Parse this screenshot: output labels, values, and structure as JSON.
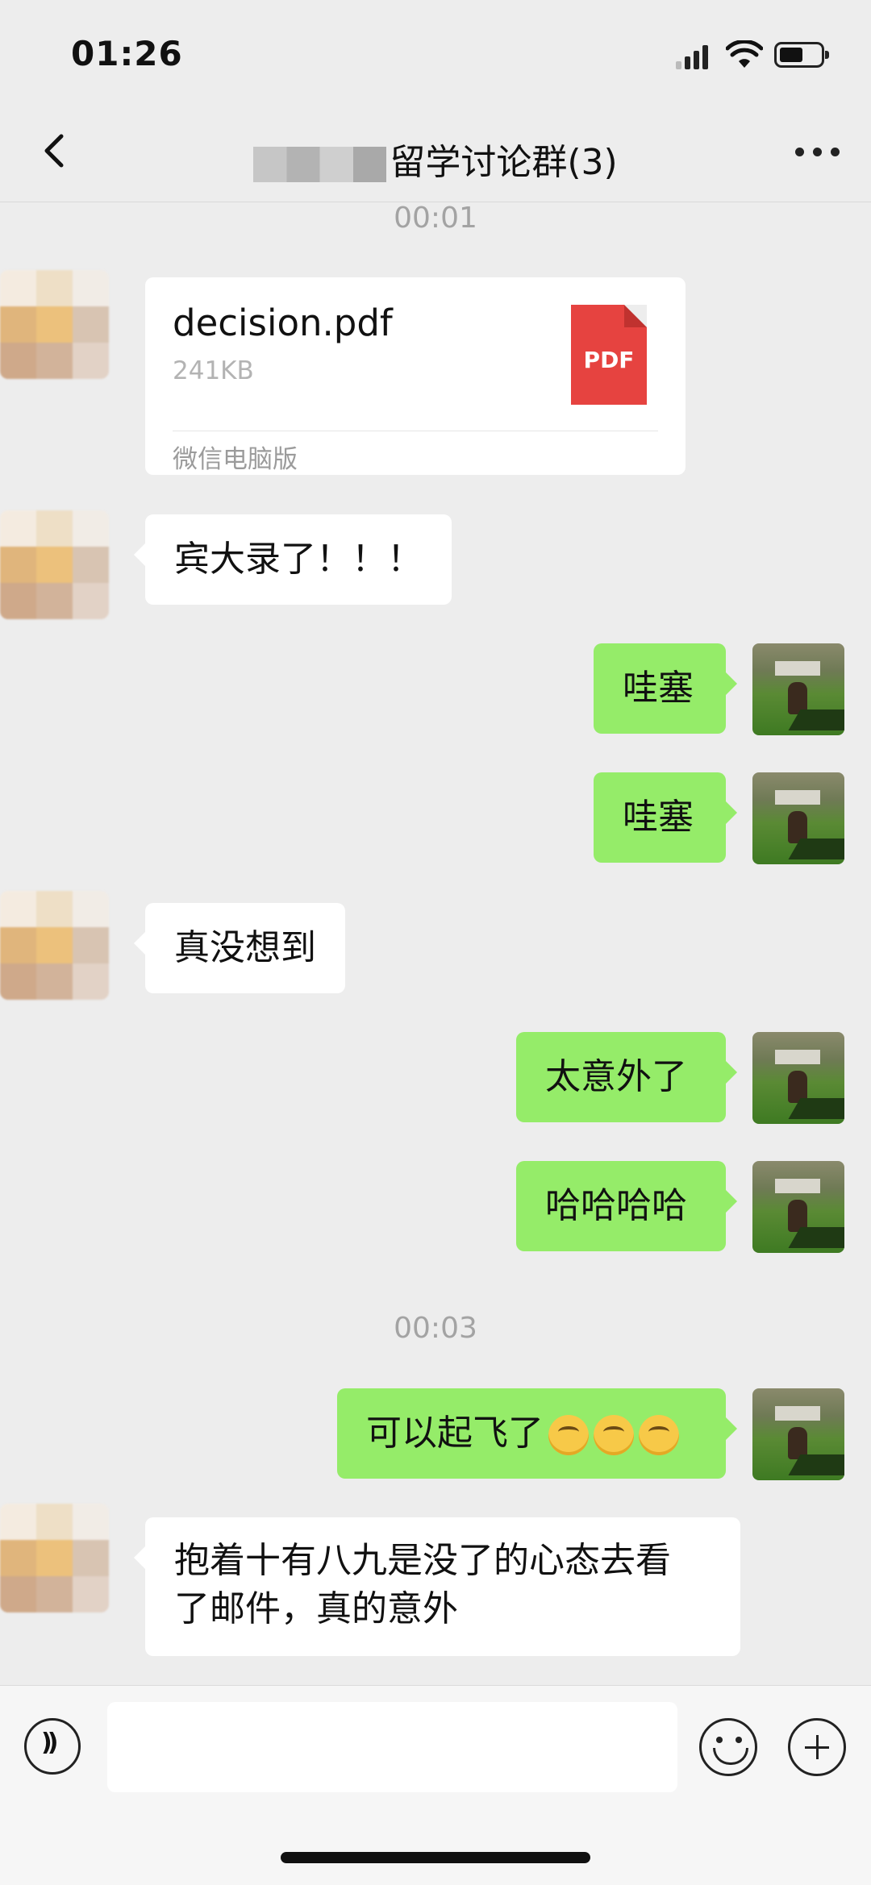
{
  "status": {
    "time": "01:26"
  },
  "nav": {
    "title": "留学讨论群(3)"
  },
  "messages": {
    "ts1": "00:01",
    "file": {
      "name": "decision.pdf",
      "size": "241KB",
      "icon_label": "PDF",
      "source": "微信电脑版"
    },
    "m1": "宾大录了！！！",
    "m2": "哇塞",
    "m3": "哇塞",
    "m4": "真没想到",
    "m5": "太意外了",
    "m6": "哈哈哈哈",
    "ts2": "00:03",
    "m7": "可以起飞了",
    "m7_emojis": [
      "hand-over-mouth-emoji",
      "hand-over-mouth-emoji",
      "hand-over-mouth-emoji"
    ],
    "m8_line1": "抱着十有八九是没了的心态去看",
    "m8_line2": "了邮件，真的意外"
  },
  "colors": {
    "background": "#ededed",
    "sent_bubble": "#95ec69",
    "received_bubble": "#ffffff",
    "pdf": "#e64340"
  }
}
